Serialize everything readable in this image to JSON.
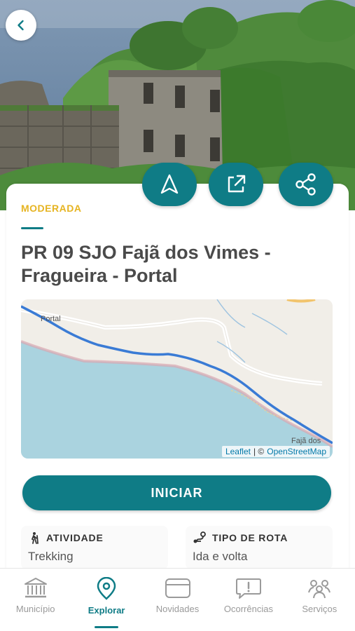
{
  "trail": {
    "difficulty": "MODERADA",
    "title": "PR 09 SJO Fajã dos Vimes - Fragueira - Portal"
  },
  "actions": {
    "back": "chevron-left-icon",
    "navigate": "navigation-arrow-icon",
    "open_external": "external-link-icon",
    "share": "share-icon"
  },
  "map": {
    "labels": [
      "Portal",
      "Fajã dos"
    ],
    "attribution_leaflet": "Leaflet",
    "attribution_sep": "| ©",
    "attribution_osm": "OpenStreetMap"
  },
  "start_button": "INICIAR",
  "info": [
    {
      "label": "ATIVIDADE",
      "value": "Trekking",
      "icon": "hiker-icon"
    },
    {
      "label": "TIPO DE ROTA",
      "value": "Ida e volta",
      "icon": "route-icon"
    }
  ],
  "nav": [
    {
      "label": "Município",
      "icon": "building-columns-icon",
      "active": false
    },
    {
      "label": "Explorar",
      "icon": "map-pin-icon",
      "active": true
    },
    {
      "label": "Novidades",
      "icon": "card-icon",
      "active": false
    },
    {
      "label": "Ocorrências",
      "icon": "alert-bubble-icon",
      "active": false
    },
    {
      "label": "Serviços",
      "icon": "people-icon",
      "active": false
    }
  ],
  "colors": {
    "accent": "#0f7c86",
    "difficulty": "#e6b422"
  }
}
